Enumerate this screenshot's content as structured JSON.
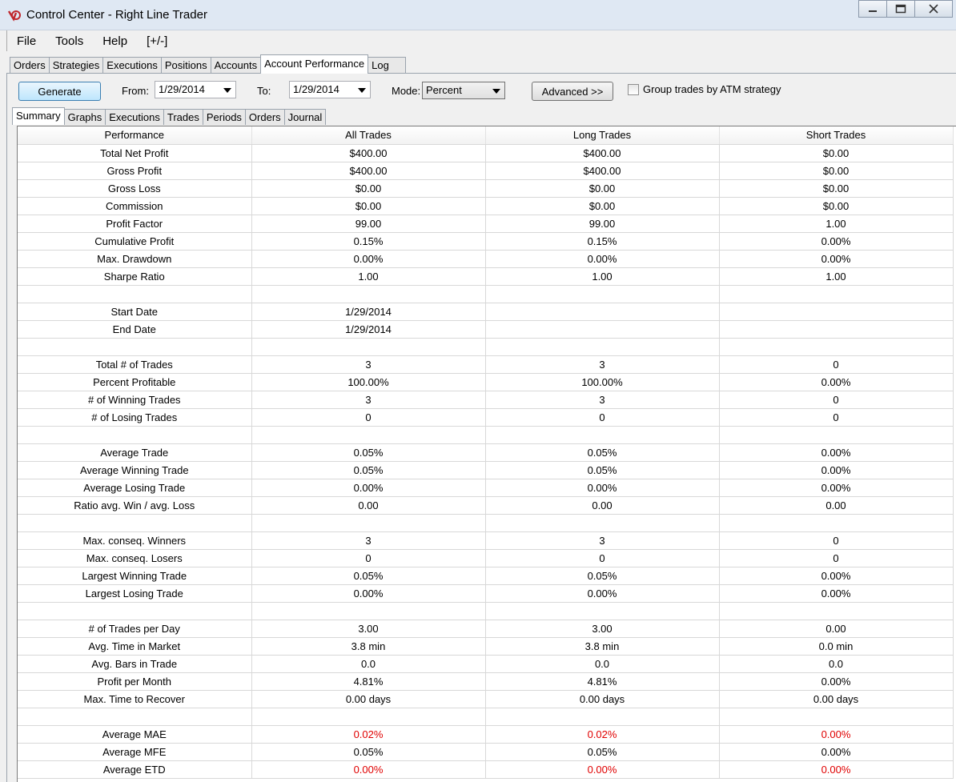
{
  "window": {
    "title": "Control Center - Right Line Trader"
  },
  "menu": [
    "File",
    "Tools",
    "Help",
    "[+/-]"
  ],
  "outer_tabs": [
    "Orders",
    "Strategies",
    "Executions",
    "Positions",
    "Accounts",
    "Account Performance",
    "Log"
  ],
  "toolbar": {
    "generate_label": "Generate",
    "from_label": "From:",
    "from_value": "1/29/2014",
    "to_label": "To:",
    "to_value": "1/29/2014",
    "mode_label": "Mode:",
    "mode_value": "Percent",
    "advanced_label": "Advanced >>",
    "group_label": "Group trades by ATM strategy"
  },
  "inner_tabs": [
    "Summary",
    "Graphs",
    "Executions",
    "Trades",
    "Periods",
    "Orders",
    "Journal"
  ],
  "table": {
    "headers": [
      "Performance",
      "All Trades",
      "Long Trades",
      "Short Trades"
    ],
    "rows": [
      [
        "Total Net Profit",
        "$400.00",
        "$400.00",
        "$0.00"
      ],
      [
        "Gross Profit",
        "$400.00",
        "$400.00",
        "$0.00"
      ],
      [
        "Gross Loss",
        "$0.00",
        "$0.00",
        "$0.00"
      ],
      [
        "Commission",
        "$0.00",
        "$0.00",
        "$0.00"
      ],
      [
        "Profit Factor",
        "99.00",
        "99.00",
        "1.00"
      ],
      [
        "Cumulative Profit",
        "0.15%",
        "0.15%",
        "0.00%"
      ],
      [
        "Max. Drawdown",
        "0.00%",
        "0.00%",
        "0.00%"
      ],
      [
        "Sharpe Ratio",
        "1.00",
        "1.00",
        "1.00"
      ],
      [
        "",
        "",
        "",
        ""
      ],
      [
        "Start Date",
        "1/29/2014",
        "",
        ""
      ],
      [
        "End Date",
        "1/29/2014",
        "",
        ""
      ],
      [
        "",
        "",
        "",
        ""
      ],
      [
        "Total # of Trades",
        "3",
        "3",
        "0"
      ],
      [
        "Percent Profitable",
        "100.00%",
        "100.00%",
        "0.00%"
      ],
      [
        "# of Winning Trades",
        "3",
        "3",
        "0"
      ],
      [
        "# of Losing Trades",
        "0",
        "0",
        "0"
      ],
      [
        "",
        "",
        "",
        ""
      ],
      [
        "Average Trade",
        "0.05%",
        "0.05%",
        "0.00%"
      ],
      [
        "Average Winning Trade",
        "0.05%",
        "0.05%",
        "0.00%"
      ],
      [
        "Average Losing Trade",
        "0.00%",
        "0.00%",
        "0.00%"
      ],
      [
        "Ratio avg. Win / avg. Loss",
        "0.00",
        "0.00",
        "0.00"
      ],
      [
        "",
        "",
        "",
        ""
      ],
      [
        "Max. conseq. Winners",
        "3",
        "3",
        "0"
      ],
      [
        "Max. conseq. Losers",
        "0",
        "0",
        "0"
      ],
      [
        "Largest Winning Trade",
        "0.05%",
        "0.05%",
        "0.00%"
      ],
      [
        "Largest Losing Trade",
        "0.00%",
        "0.00%",
        "0.00%"
      ],
      [
        "",
        "",
        "",
        ""
      ],
      [
        "# of Trades per Day",
        "3.00",
        "3.00",
        "0.00"
      ],
      [
        "Avg. Time in Market",
        "3.8 min",
        "3.8 min",
        "0.0 min"
      ],
      [
        "Avg. Bars in Trade",
        "0.0",
        "0.0",
        "0.0"
      ],
      [
        "Profit per Month",
        "4.81%",
        "4.81%",
        "0.00%"
      ],
      [
        "Max. Time to Recover",
        "0.00 days",
        "0.00 days",
        "0.00 days"
      ],
      [
        "",
        "",
        "",
        ""
      ],
      [
        "Average MAE",
        "0.02%",
        "0.02%",
        "0.00%"
      ],
      [
        "Average MFE",
        "0.05%",
        "0.05%",
        "0.00%"
      ],
      [
        "Average ETD",
        "0.00%",
        "0.00%",
        "0.00%"
      ]
    ],
    "negative_rows": [
      "Average MAE",
      "Average ETD"
    ]
  },
  "colors": {
    "negative": "#e00000",
    "accent": "#3c7fb1"
  }
}
